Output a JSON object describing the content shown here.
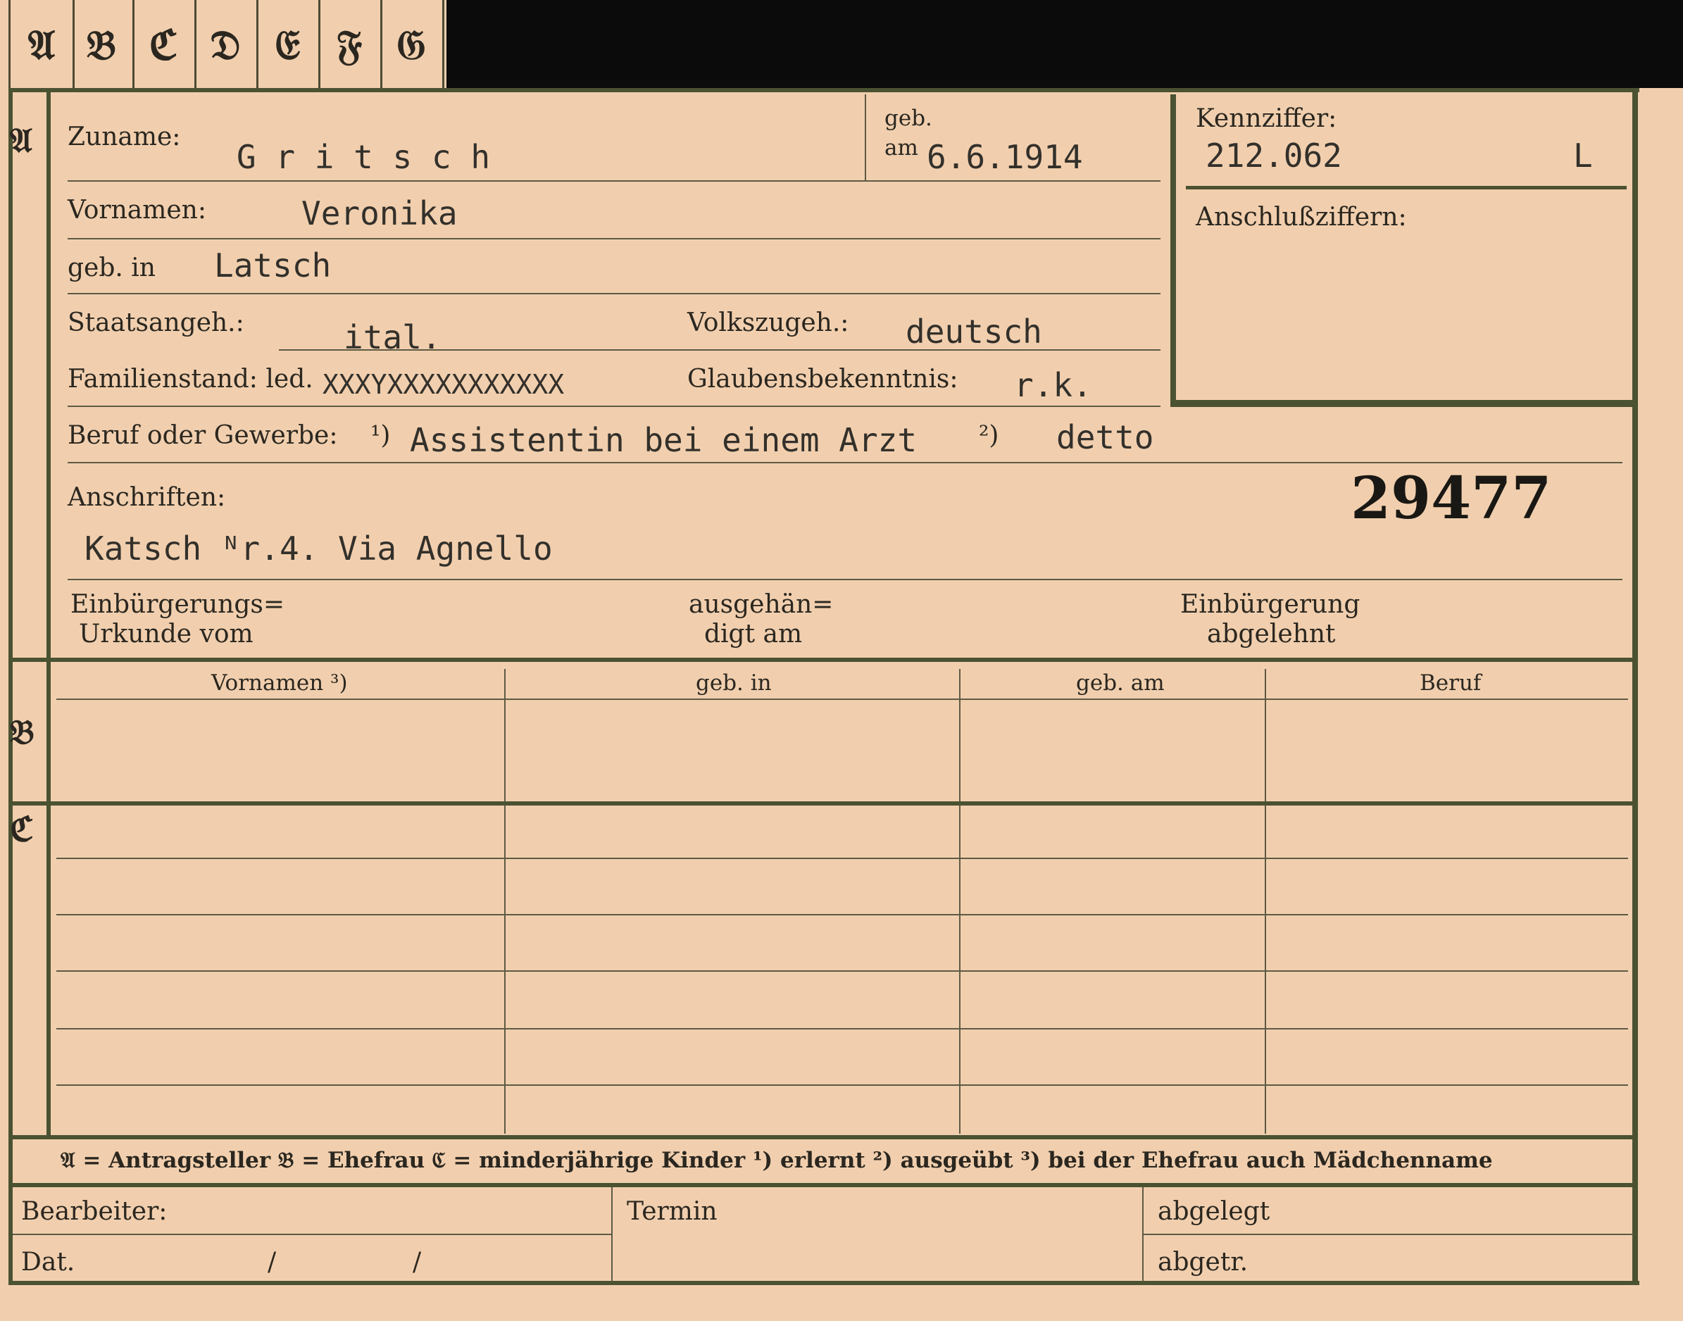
{
  "tabs": [
    "𝔄",
    "𝔅",
    "ℭ",
    "𝔇",
    "𝔈",
    "𝔉",
    "𝔊"
  ],
  "sections": {
    "a": "𝔄",
    "b": "𝔅",
    "c": "ℭ"
  },
  "fields": {
    "zuname_label": "Zuname:",
    "zuname_value": "G r i t s c h",
    "geb_label": "geb.",
    "am_label": "am",
    "geb_am_value": "6.6.1914",
    "vornamen_label": "Vornamen:",
    "vornamen_value": "Veronika",
    "geb_in_label": "geb. in",
    "geb_in_value": "Latsch",
    "staatsangeh_label": "Staatsangeh.:",
    "staatsangeh_value": "ital.",
    "volkszugeh_label": "Volkszugeh.:",
    "volkszugeh_value": "deutsch",
    "familienstand_label": "Familienstand: led.",
    "familienstand_struck": "XXXYXXXXXXXXXXX",
    "glaubens_label": "Glaubensbekenntnis:",
    "glaubens_value": "r.k.",
    "beruf_label": "Beruf oder Gewerbe:",
    "beruf_mark1": "¹)",
    "beruf_value1": "Assistentin bei einem Arzt",
    "beruf_mark2": "²)",
    "beruf_value2": "detto",
    "anschriften_label": "Anschriften:",
    "anschriften_value": "Katsch ᴺr.4. Via Agnello",
    "stamp_number": "29477",
    "einb_urkunde_1": "Einbürgerungs=",
    "einb_urkunde_2": "Urkunde vom",
    "ausgehaen_1": "ausgehän=",
    "ausgehaen_2": "digt am",
    "einb_abgelehnt_1": "Einbürgerung",
    "einb_abgelehnt_2": "abgelehnt"
  },
  "kennziffer": {
    "label": "Kennziffer:",
    "value": "212.062",
    "letter": "L",
    "anschluss_label": "Anschlußziffern:"
  },
  "table": {
    "headers": [
      "Vornamen ³)",
      "geb. in",
      "geb. am",
      "Beruf"
    ]
  },
  "legend": "𝔄 = Antragsteller   𝔅 = Ehefrau   ℭ = minderjährige Kinder   ¹) erlernt   ²) ausgeübt   ³) bei der Ehefrau auch Mädchenname",
  "footer": {
    "bearbeiter": "Bearbeiter:",
    "dat": "Dat.",
    "slash1": "/",
    "slash2": "/",
    "termin": "Termin",
    "abgelegt": "abgelegt",
    "abgetr": "abgetr."
  }
}
